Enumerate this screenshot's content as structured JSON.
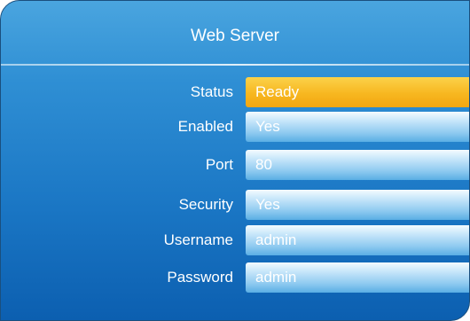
{
  "title": "Web Server",
  "fields": [
    {
      "label": "Status",
      "value": "Ready",
      "highlight_color": "#f7b720"
    },
    {
      "label": "Enabled",
      "value": "Yes"
    },
    {
      "label": "Port",
      "value": "80"
    },
    {
      "label": "Security",
      "value": "Yes"
    },
    {
      "label": "Username",
      "value": "admin"
    },
    {
      "label": "Password",
      "value": "admin"
    }
  ],
  "colors": {
    "panel_top": "#4aa5df",
    "panel_bottom": "#0c5fb0",
    "field_light": "#f4fbff",
    "field_dark": "#5aaee4"
  }
}
